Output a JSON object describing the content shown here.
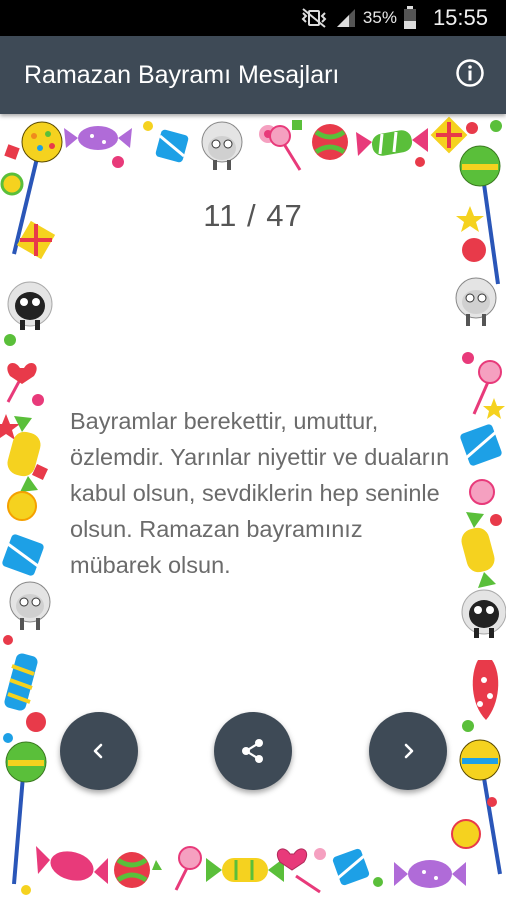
{
  "status_bar": {
    "battery_percent": "35%",
    "time": "15:55",
    "icons": [
      "mute-vibrate-icon",
      "signal-icon",
      "battery-icon"
    ]
  },
  "app_bar": {
    "title": "Ramazan Bayramı Mesajları",
    "info_icon": "info-icon",
    "color": "#3e4a56"
  },
  "counter": {
    "text": "11 / 47"
  },
  "message": {
    "text": "Bayramlar berekettir, umuttur, özlemdir. Yarınlar niyettir ve duaların kabul olsun, sevdiklerin hep seninle olsun. Ramazan bayramınız mübarek olsun."
  },
  "controls": {
    "previous_icon": "chevron-left-icon",
    "share_icon": "share-icon",
    "next_icon": "chevron-right-icon"
  }
}
